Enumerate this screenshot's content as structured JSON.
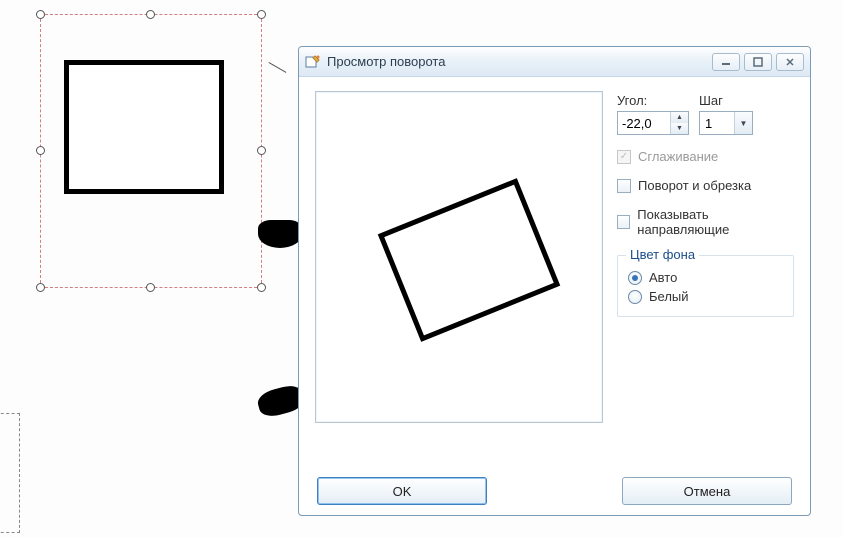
{
  "editor": {
    "selection_shape": "rectangle"
  },
  "dialog": {
    "title": "Просмотр поворота",
    "angle": {
      "label": "Угол:",
      "value": "-22,0"
    },
    "step": {
      "label": "Шаг",
      "value": "1"
    },
    "smoothing": {
      "label": "Сглаживание",
      "checked": true,
      "enabled": false
    },
    "rotate_crop": {
      "label": "Поворот и обрезка",
      "checked": false,
      "enabled": true
    },
    "show_guides": {
      "label": "Показывать направляющие",
      "checked": false,
      "enabled": true
    },
    "bgcolor": {
      "legend": "Цвет фона",
      "auto": {
        "label": "Авто",
        "checked": true
      },
      "white": {
        "label": "Белый",
        "checked": false
      }
    },
    "buttons": {
      "ok": "OK",
      "cancel": "Отмена"
    }
  },
  "chart_data": null
}
